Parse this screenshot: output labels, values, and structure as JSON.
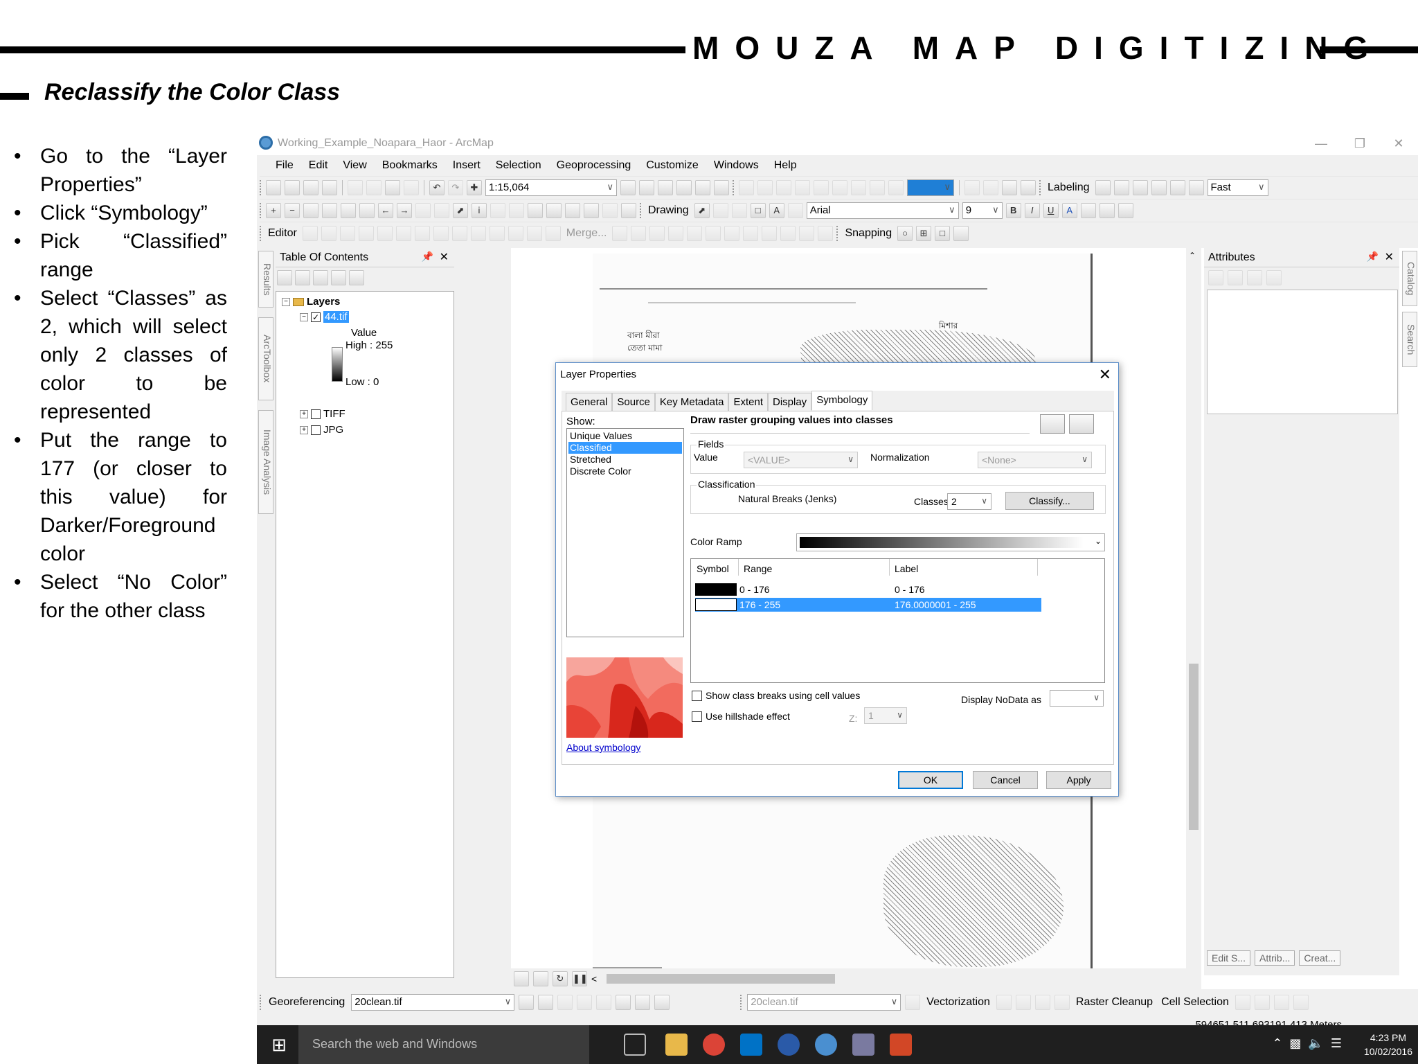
{
  "slide": {
    "title": "MOUZA MAP DIGITIZING",
    "section_title": "Reclassify the Color Class",
    "steps": [
      "Go to the “Layer Properties”",
      "Click “Symbology”",
      "Pick “Classified” range",
      "Select “Classes” as 2, which will select only 2 classes of color to be represented",
      "Put the range to 177 (or closer to this value) for Darker/Foreground color",
      "Select “No Color” for the other class"
    ]
  },
  "window": {
    "title": "Working_Example_Noapara_Haor - ArcMap",
    "menu": [
      "File",
      "Edit",
      "View",
      "Bookmarks",
      "Insert",
      "Selection",
      "Geoprocessing",
      "Customize",
      "Windows",
      "Help"
    ]
  },
  "toolbars": {
    "scale": "1:15,064",
    "labeling": "Labeling",
    "quality": "Fast",
    "drawing": "Drawing",
    "font": "Arial",
    "font_size": "9",
    "bold": "B",
    "italic": "I",
    "underline": "U",
    "editor": "Editor",
    "merge": "Merge...",
    "snapping": "Snapping"
  },
  "left_dock_tabs": [
    "Results",
    "ArcToolbox",
    "Image Analysis"
  ],
  "toc": {
    "title": "Table Of Contents",
    "root": "Layers",
    "selected_layer": "44.tif",
    "value_label": "Value",
    "high": "High : 255",
    "low": "Low : 0",
    "groups": [
      "TIFF",
      "JPG"
    ]
  },
  "attributes": {
    "title": "Attributes",
    "tabs": [
      "Edit S...",
      "Attrib...",
      "Creat..."
    ]
  },
  "right_dock_tabs": [
    "Catalog",
    "Search"
  ],
  "bottom_toolbar": {
    "georeferencing": "Georeferencing",
    "georef_layer": "20clean.tif",
    "vector_layer": "20clean.tif",
    "vectorization": "Vectorization",
    "raster_cleanup": "Raster Cleanup",
    "cell_selection": "Cell Selection"
  },
  "status": {
    "coordinates": "594651.511  693191.413 Meters"
  },
  "taskbar": {
    "search_placeholder": "Search the web and Windows",
    "time": "4:23 PM",
    "date": "10/02/2016"
  },
  "dialog": {
    "title": "Layer Properties",
    "tabs": [
      "General",
      "Source",
      "Key Metadata",
      "Extent",
      "Display",
      "Symbology"
    ],
    "active_tab": "Symbology",
    "show_label": "Show:",
    "show_items": [
      "Unique Values",
      "Classified",
      "Stretched",
      "Discrete Color"
    ],
    "selected_show_item": "Classified",
    "description": "Draw raster grouping values into classes",
    "fields_label": "Fields",
    "value_label": "Value",
    "value_field": "<VALUE>",
    "normalization_label": "Normalization",
    "normalization_field": "<None>",
    "classification_label": "Classification",
    "method": "Natural Breaks (Jenks)",
    "classes_label": "Classes",
    "classes_value": "2",
    "classify_button": "Classify...",
    "color_ramp_label": "Color Ramp",
    "columns": [
      "Symbol",
      "Range",
      "Label"
    ],
    "rows": [
      {
        "range": "0 - 176",
        "label": "0 - 176",
        "symbol_color": "#000000"
      },
      {
        "range": "176 - 255",
        "label": "176.0000001 - 255",
        "symbol_color": "#ffffff"
      }
    ],
    "show_breaks_label": "Show class breaks using cell values",
    "hillshade_label": "Use hillshade effect",
    "z_label": "Z:",
    "z_value": "1",
    "nodata_label": "Display NoData as",
    "about_link": "About symbology",
    "ok": "OK",
    "cancel": "Cancel",
    "apply": "Apply"
  },
  "colors": {
    "selection": "#3399ff",
    "taskbar": "#1f1f1f",
    "dialog_border": "#5c8ec9"
  }
}
